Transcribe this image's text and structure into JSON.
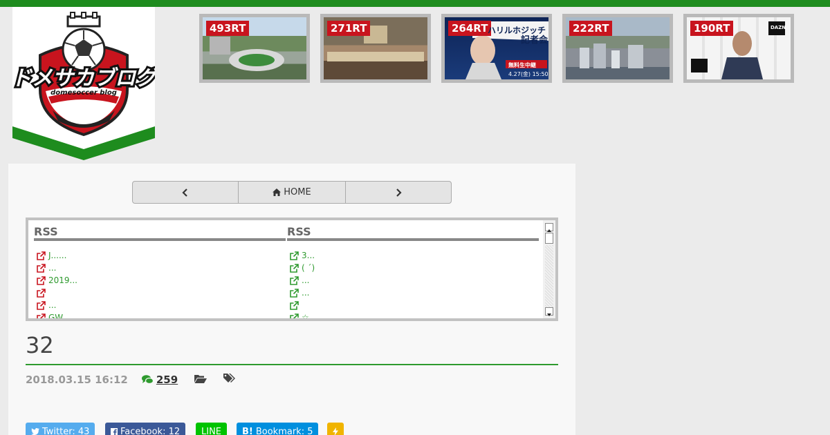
{
  "logo": {
    "title": "ドメサカブログ",
    "subtitle": "domesoccer blog"
  },
  "ranking": [
    {
      "badge": "493RT"
    },
    {
      "badge": "271RT"
    },
    {
      "badge": "264RT",
      "caption_top": "ハリルホジッチ",
      "caption_side": "記者会",
      "caption_live": "無料生中継",
      "caption_time": "4.27(金) 15:50～"
    },
    {
      "badge": "222RT"
    },
    {
      "badge": "190RT",
      "sponsor": "DAZN"
    }
  ],
  "nav": {
    "home_label": "HOME"
  },
  "rss": {
    "left": {
      "heading": "RSS",
      "items": [
        "J......",
        "...",
        "2019...",
        "",
        "...",
        "GW..."
      ]
    },
    "right": {
      "heading": "RSS",
      "items": [
        "3...",
        "( ´)",
        "...",
        "...",
        "",
        "☆..."
      ]
    }
  },
  "post": {
    "title": "32",
    "date": "2018.03.15 16:12",
    "comment_count": "259"
  },
  "share": {
    "twitter": "Twitter: 43",
    "facebook": "Facebook: 12",
    "line": "LINE",
    "hatena_prefix": "B!",
    "hatena": "Bookmark: 5"
  },
  "colors": {
    "accent_green": "#1e8c1e",
    "badge_red": "#c8141e",
    "link_green": "#2e9a2e"
  }
}
